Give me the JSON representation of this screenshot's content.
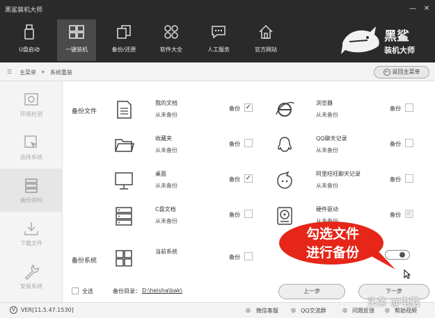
{
  "window": {
    "title": "黑鲨装机大师",
    "minimize": "—",
    "close": "✕"
  },
  "topnav": [
    {
      "label": "U盘启动",
      "icon": "usb-icon"
    },
    {
      "label": "一键装机",
      "icon": "windows-icon"
    },
    {
      "label": "备份/还原",
      "icon": "backup-restore-icon"
    },
    {
      "label": "软件大全",
      "icon": "apps-icon"
    },
    {
      "label": "人工服务",
      "icon": "chat-service-icon"
    },
    {
      "label": "官方网站",
      "icon": "home-icon"
    }
  ],
  "brand": {
    "text1": "黑鲨",
    "text2": "装机大师"
  },
  "breadcrumb": {
    "home": "主菜单",
    "sep": "▶",
    "current": "系统重装"
  },
  "back_button": "返回主菜单",
  "sidebar": [
    {
      "label": "环境检测",
      "icon": "environment-check-icon"
    },
    {
      "label": "选择系统",
      "icon": "select-system-icon"
    },
    {
      "label": "备份资料",
      "icon": "backup-data-icon"
    },
    {
      "label": "下载文件",
      "icon": "download-icon"
    },
    {
      "label": "安装系统",
      "icon": "wrench-icon"
    }
  ],
  "sections": {
    "files": "备份文件",
    "system": "备份系统"
  },
  "backup_label": "备份",
  "items_left": [
    {
      "name": "我的文档",
      "status": "从未备份",
      "checked": "✓"
    },
    {
      "name": "收藏夹",
      "status": "从未备份",
      "checked": ""
    },
    {
      "name": "桌面",
      "status": "从未备份",
      "checked": "✓"
    },
    {
      "name": "C盘文档",
      "status": "从未备份",
      "checked": ""
    },
    {
      "name": "当前系统",
      "status": "",
      "checked": ""
    }
  ],
  "items_right": [
    {
      "name": "浏览器",
      "status": "从未备份",
      "checked": ""
    },
    {
      "name": "QQ聊天记录",
      "status": "从未备份",
      "checked": ""
    },
    {
      "name": "阿里旺旺聊天记录",
      "status": "从未备份",
      "checked": ""
    },
    {
      "name": "硬件驱动",
      "status": "从未备份",
      "checked": "✓"
    }
  ],
  "select_all": "全选",
  "backup_dir_label": "备份目录：",
  "backup_dir": "D:\\heisha\\bak\\",
  "prev_button": "上一步",
  "next_button": "下一步",
  "annotation": {
    "line1": "勾选文件",
    "line2": "进行备份"
  },
  "statusbar": {
    "version": "VER[11.5.47.1530]",
    "wechat": "微信客服",
    "qq": "QQ交流群",
    "feedback": "问题反馈",
    "help": "帮助视频"
  },
  "watermark": "头条 @电脑",
  "colors": {
    "dark": "#2b2b2b",
    "active_nav": "#4a4a4a",
    "bubble": "#e52619"
  }
}
